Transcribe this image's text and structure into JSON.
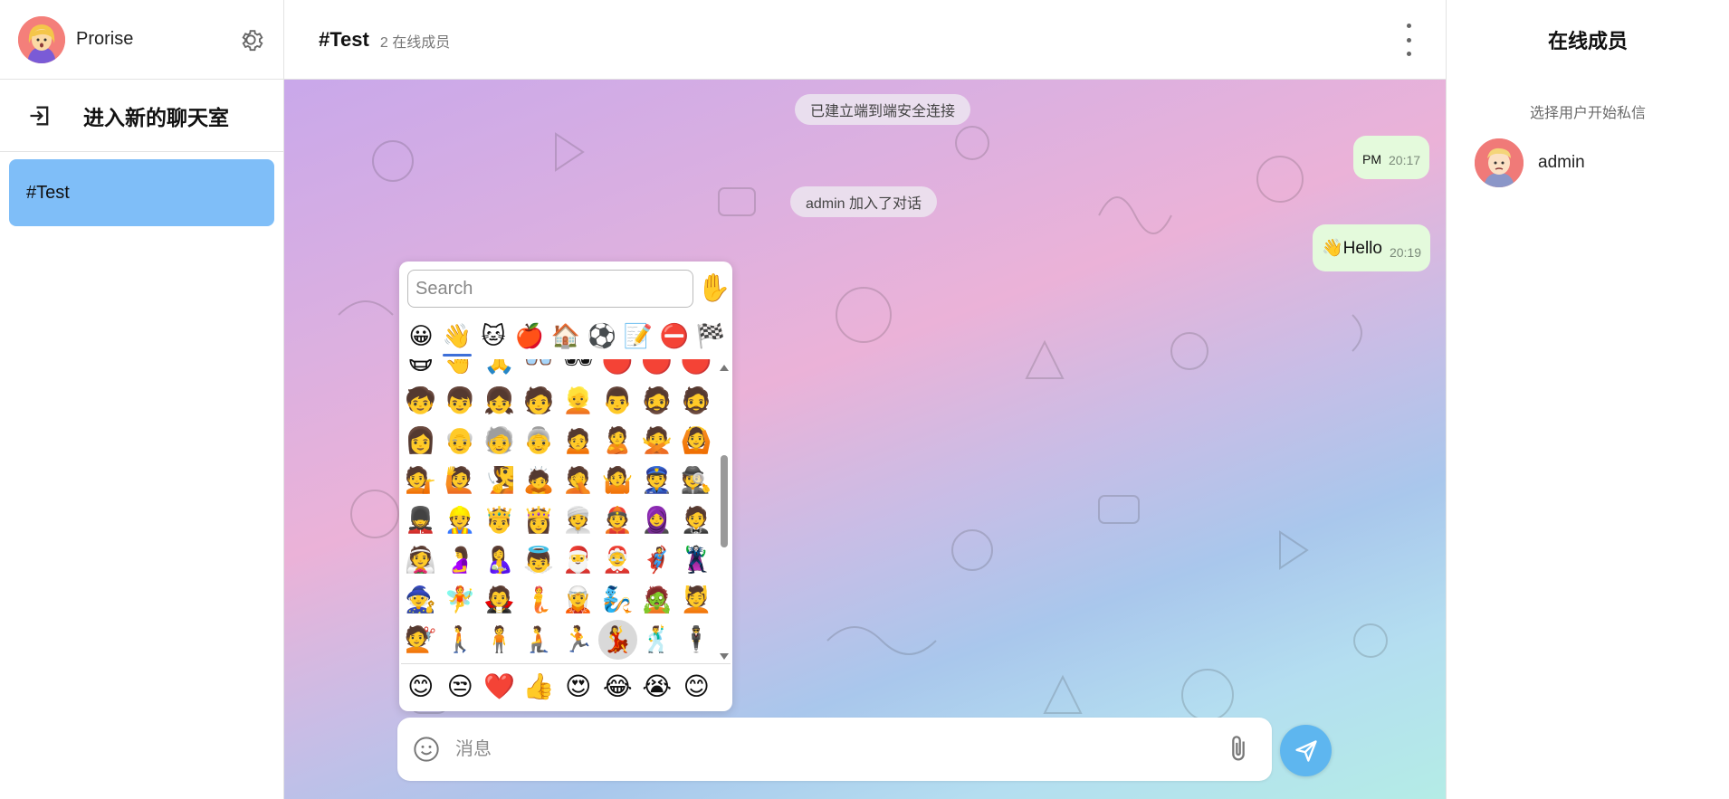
{
  "user": {
    "name": "Prorise",
    "avatar_icon": "woman-face-avatar",
    "settings_icon": "gear-icon"
  },
  "sidebar": {
    "join_room_label": "进入新的聊天室",
    "join_room_icon": "enter-door-icon",
    "rooms": [
      {
        "label": "#Test",
        "active": true
      }
    ]
  },
  "chat": {
    "room_title": "#Test",
    "online_count": "2 在线成员",
    "messages": [
      {
        "type": "system",
        "text": "已建立端到端安全连接"
      },
      {
        "type": "bubble",
        "text": "PM",
        "time": "20:17"
      },
      {
        "type": "system",
        "text": "admin 加入了对话"
      },
      {
        "type": "bubble",
        "text": "👋Hello",
        "time": "20:19"
      }
    ]
  },
  "emoji_picker": {
    "search_placeholder": "Search",
    "skin_tone_emoji": "✋",
    "categories": [
      "😀",
      "👋",
      "🐱",
      "🍎",
      "🏠",
      "⚽",
      "📝",
      "⛔",
      "🏁"
    ],
    "active_category": 1,
    "grid": [
      "😷",
      "🤚",
      "🙏",
      "👓",
      "🕶",
      "🔴",
      "🔴",
      "🔴",
      "🧒",
      "👦",
      "👧",
      "🧑",
      "👱",
      "👨",
      "🧔",
      "🧔",
      "👩",
      "👴",
      "🧓",
      "👵",
      "🙍",
      "🙎",
      "🙅",
      "🙆",
      "💁",
      "🙋",
      "🧏",
      "🙇",
      "🤦",
      "🤷",
      "👮",
      "🕵",
      "💂",
      "👷",
      "🤴",
      "👸",
      "👳",
      "👲",
      "🧕",
      "🤵",
      "👰",
      "🤰",
      "🤱",
      "👼",
      "🎅",
      "🤶",
      "🦸",
      "🦹",
      "🧙",
      "🧚",
      "🧛",
      "🧜",
      "🧝",
      "🧞",
      "🧟",
      "💆",
      "💇",
      "🚶",
      "🧍",
      "🧎",
      "🏃",
      "💃",
      "🕺",
      "🕴",
      "👯",
      "🧖",
      "🧗",
      "🤺",
      "🏇",
      "⛷",
      "🏂",
      "🏌"
    ],
    "recent": [
      "😊",
      "😒",
      "❤️",
      "👍",
      "😍",
      "😂",
      "😭",
      "😊"
    ]
  },
  "composer": {
    "placeholder": "消息",
    "emoji_icon": "smile-icon",
    "attach_icon": "paperclip-icon",
    "send_icon": "paper-plane-icon"
  },
  "members_panel": {
    "title": "在线成员",
    "hint": "选择用户开始私信",
    "members": [
      {
        "name": "admin",
        "avatar_icon": "man-face-avatar"
      }
    ]
  },
  "colors": {
    "active_room": "#7fbef8",
    "bubble": "#e4fadc",
    "send_button": "#5eb6ef",
    "category_underline": "#3d6fd8"
  }
}
